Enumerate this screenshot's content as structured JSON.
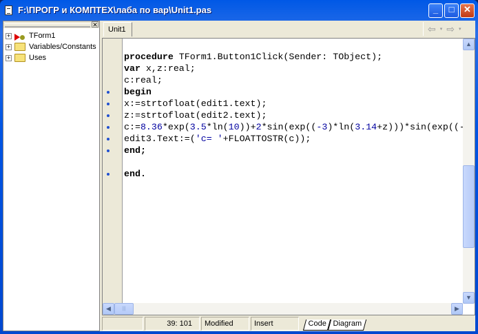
{
  "window": {
    "title": "F:\\ПРОГР и КОМПТЕХ\\лаба по вар\\Unit1.pas",
    "minimize": "_",
    "maximize": "□",
    "close": "✕"
  },
  "explorer": {
    "close": "✕",
    "nodes": [
      {
        "label": "TForm1",
        "icon": "form-icon"
      },
      {
        "label": "Variables/Constants",
        "icon": "folder-icon"
      },
      {
        "label": "Uses",
        "icon": "folder-icon"
      }
    ]
  },
  "tabs": {
    "active": "Unit1",
    "back": "⇦",
    "forward": "⇨",
    "dropdown": "▾"
  },
  "code": {
    "lines": [
      [
        {
          "t": "procedure",
          "c": "kw"
        },
        {
          "t": " TForm1.Button1Click(Sender: TObject);"
        }
      ],
      [
        {
          "t": "var",
          "c": "kw"
        },
        {
          "t": " x,z:real;"
        }
      ],
      [
        {
          "t": "c:real;"
        }
      ],
      [
        {
          "t": "begin",
          "c": "kw"
        }
      ],
      [
        {
          "t": "x:=strtofloat(edit1.text);"
        }
      ],
      [
        {
          "t": "z:=strtofloat(edit2.text);"
        }
      ],
      [
        {
          "t": "c:="
        },
        {
          "t": "8.36",
          "c": "num"
        },
        {
          "t": "*exp("
        },
        {
          "t": "3.5",
          "c": "num"
        },
        {
          "t": "*ln("
        },
        {
          "t": "10",
          "c": "num"
        },
        {
          "t": "))+"
        },
        {
          "t": "2",
          "c": "num"
        },
        {
          "t": "*sin(exp(("
        },
        {
          "t": "-3",
          "c": "num"
        },
        {
          "t": ")*ln("
        },
        {
          "t": "3.14",
          "c": "num"
        },
        {
          "t": "+z)))*sin(exp((-"
        }
      ],
      [
        {
          "t": "edit3.Text:=("
        },
        {
          "t": "'c= '",
          "c": "str"
        },
        {
          "t": "+FLOATTOSTR(c));"
        }
      ],
      [
        {
          "t": "end;",
          "c": "kw"
        }
      ],
      [],
      [
        {
          "t": "end.",
          "c": "kw"
        }
      ]
    ],
    "breakpoint_dots": [
      3,
      4,
      5,
      6,
      7,
      8,
      10
    ]
  },
  "status": {
    "position": "39: 101",
    "modified": "Modified",
    "mode": "Insert",
    "view_tabs": [
      "Code",
      "Diagram"
    ]
  }
}
